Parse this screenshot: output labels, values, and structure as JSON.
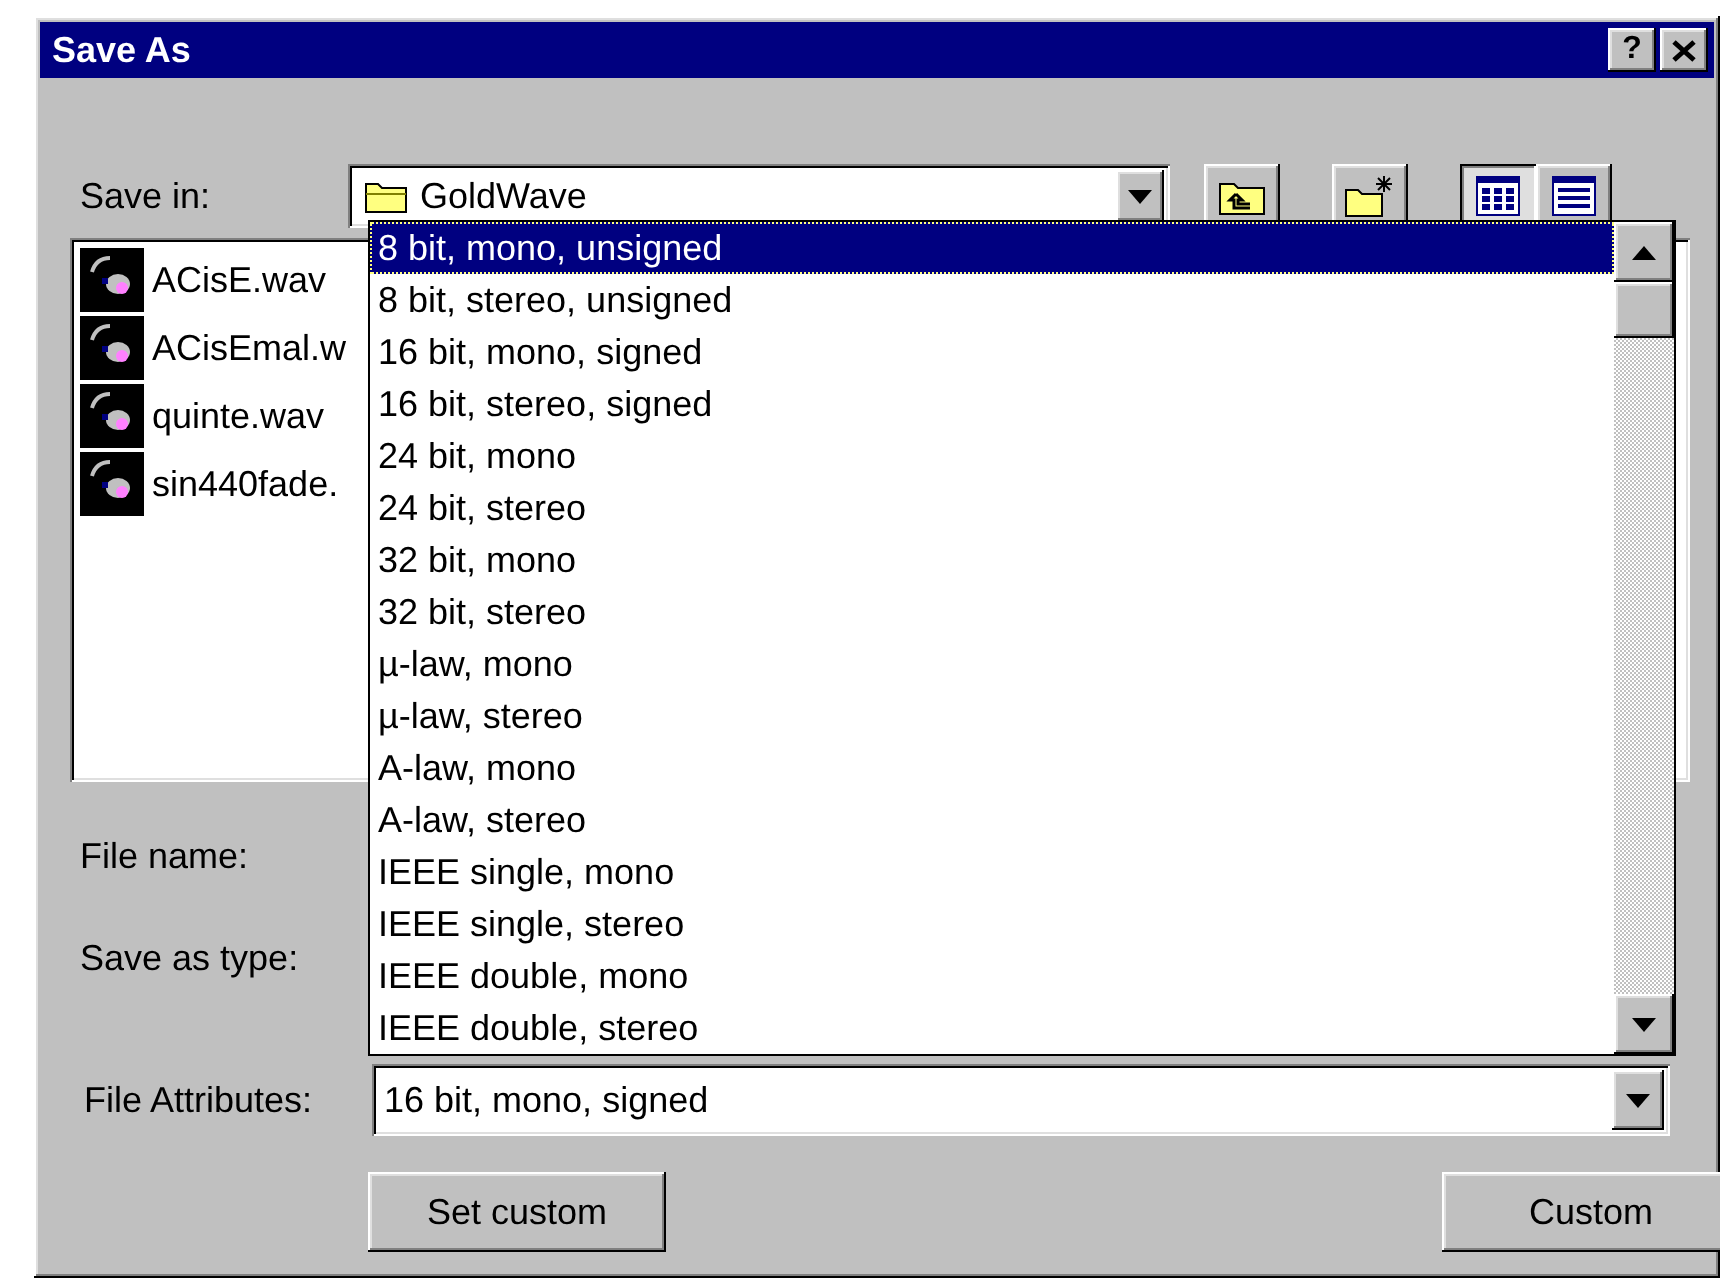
{
  "window": {
    "title": "Save As",
    "help_button": "?"
  },
  "save_in": {
    "label": "Save in:",
    "value": "GoldWave"
  },
  "toolbar": [
    {
      "kind": "up-folder",
      "pressed": false
    },
    {
      "kind": "new-folder",
      "pressed": false
    },
    {
      "kind": "list",
      "pressed": true
    },
    {
      "kind": "details",
      "pressed": false
    }
  ],
  "files": [
    {
      "name": "ACisE.wav"
    },
    {
      "name": "ACisEmal.w"
    },
    {
      "name": "quinte.wav"
    },
    {
      "name": "sin440fade."
    }
  ],
  "file_name": {
    "label": "File name:"
  },
  "save_as_type": {
    "label": "Save as type:"
  },
  "file_attributes": {
    "label": "File Attributes:",
    "value": "16 bit, mono, signed"
  },
  "dropdown": {
    "items": [
      {
        "label": "8 bit, mono, unsigned",
        "selected": true
      },
      {
        "label": "8 bit, stereo, unsigned",
        "selected": false
      },
      {
        "label": "16 bit, mono, signed",
        "selected": false
      },
      {
        "label": "16 bit, stereo, signed",
        "selected": false
      },
      {
        "label": "24 bit, mono",
        "selected": false
      },
      {
        "label": "24 bit, stereo",
        "selected": false
      },
      {
        "label": "32 bit, mono",
        "selected": false
      },
      {
        "label": "32 bit, stereo",
        "selected": false
      },
      {
        "label": "µ-law, mono",
        "selected": false
      },
      {
        "label": "µ-law, stereo",
        "selected": false
      },
      {
        "label": "A-law, mono",
        "selected": false
      },
      {
        "label": "A-law, stereo",
        "selected": false
      },
      {
        "label": "IEEE single, mono",
        "selected": false
      },
      {
        "label": "IEEE single, stereo",
        "selected": false
      },
      {
        "label": "IEEE double, mono",
        "selected": false
      },
      {
        "label": "IEEE double, stereo",
        "selected": false
      }
    ]
  },
  "buttons": [
    "Set custom",
    "Custom"
  ]
}
